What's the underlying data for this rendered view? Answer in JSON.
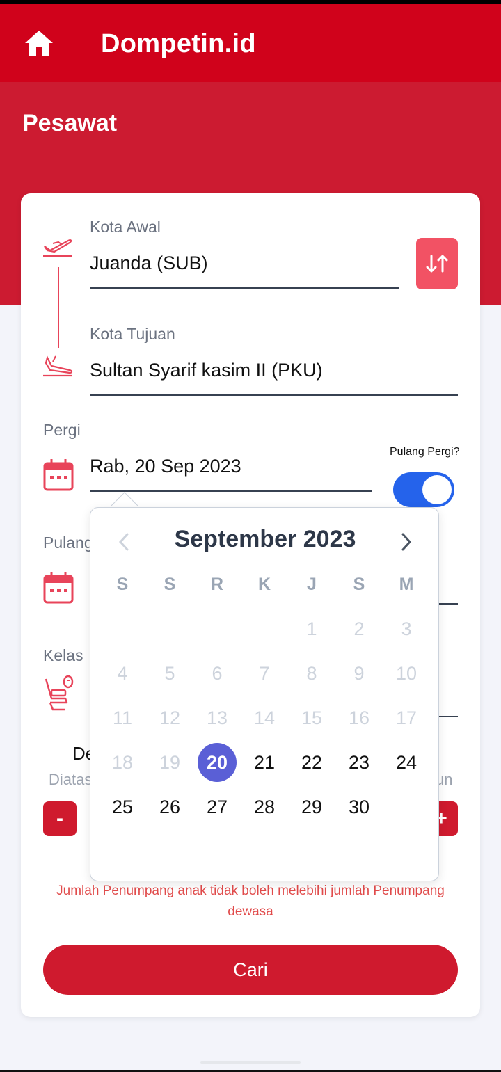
{
  "app": {
    "title": "Dompetin.id"
  },
  "page": {
    "title": "Pesawat"
  },
  "form": {
    "origin_label": "Kota Awal",
    "origin_value": "Juanda (SUB)",
    "destination_label": "Kota Tujuan",
    "destination_value": "Sultan Syarif kasim II (PKU)",
    "depart_label": "Pergi",
    "depart_value": "Rab, 20 Sep 2023",
    "return_label": "Pulang",
    "roundtrip_label": "Pulang Pergi?",
    "roundtrip_on": true,
    "class_label": "Kelas",
    "adult_title": "De",
    "adult_subtitle": "Diatas",
    "child_subtitle_tail": "un",
    "minus_label": "-",
    "plus_label": "+",
    "warning": "Jumlah Penumpang anak tidak boleh melebihi jumlah Penumpang dewasa",
    "search_button": "Cari"
  },
  "calendar": {
    "month_title": "September 2023",
    "weekdays": [
      "S",
      "S",
      "R",
      "K",
      "J",
      "S",
      "M"
    ],
    "leading_blanks": 4,
    "days": 30,
    "selected_day": 20,
    "disabled_before": 20
  },
  "colors": {
    "brand_red": "#d0021b",
    "accent_blue": "#2563eb",
    "selected_day": "#5a5fd6"
  }
}
